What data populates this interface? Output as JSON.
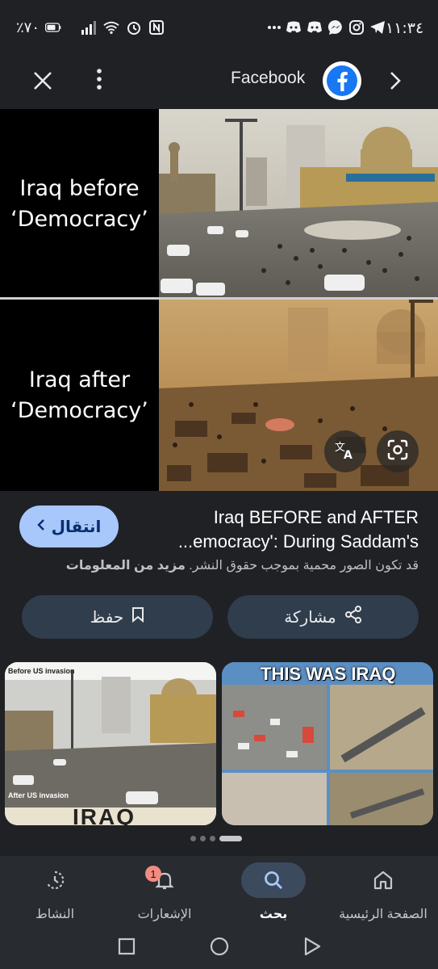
{
  "status_bar": {
    "battery": "٪٧٠",
    "time": "١١:٣٤"
  },
  "top_bar": {
    "source_name": "Facebook",
    "brand_color": "#1877f2"
  },
  "image": {
    "top_caption": "Iraq before\n‘Democracy’",
    "bottom_caption": "Iraq after\n‘Democracy’"
  },
  "result": {
    "visit_button_label": "انتقال",
    "title_line1": "Iraq BEFORE and AFTER",
    "title_line2": "...emocracy': During Saddam's",
    "copyright_notice": "قد تكون الصور محمية بموجب حقوق النشر.",
    "learn_more_link": "مزيد من المعلومات",
    "share_label": "مشاركة",
    "save_label": "حفظ"
  },
  "related": [
    {
      "header_text": "Before US invasion",
      "footer_small": "After US invasion",
      "footer_big": "IRAQ"
    },
    {
      "header_text": "THIS WAS IRAQ"
    }
  ],
  "bottom_nav": {
    "items": [
      {
        "label": "الصفحة الرئيسية",
        "icon": "home-icon"
      },
      {
        "label": "بحث",
        "icon": "search-icon",
        "active": true
      },
      {
        "label": "الإشعارات",
        "icon": "bell-icon",
        "badge": "1"
      },
      {
        "label": "النشاط",
        "icon": "activity-icon"
      }
    ]
  }
}
